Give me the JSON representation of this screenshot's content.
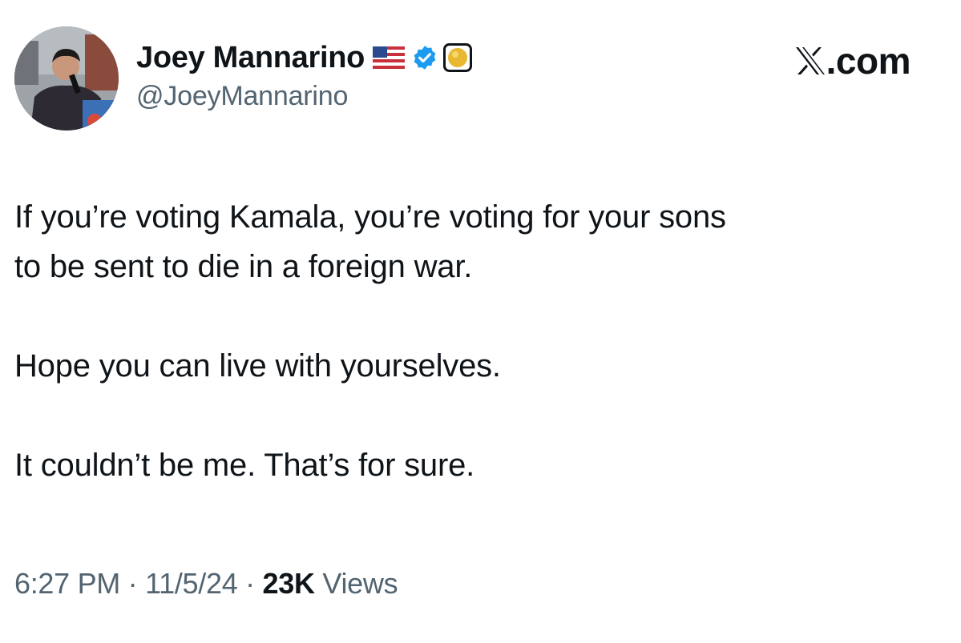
{
  "author": {
    "display_name": "Joey Mannarino",
    "handle": "@JoeyMannarino",
    "badges": [
      "us-flag-icon",
      "verified-icon",
      "affiliate-icon"
    ],
    "avatar": "avatar"
  },
  "brand": {
    "text": ".com"
  },
  "tweet": {
    "line1": "If you’re voting Kamala, you’re voting for your sons",
    "line2": "to be sent to die in a foreign war.",
    "paragraph2": "Hope you can live with yourselves.",
    "paragraph3": "It couldn’t be me. That’s for sure."
  },
  "meta": {
    "time": "6:27 PM",
    "sep1": "·",
    "date": "11/5/24",
    "sep2": "·",
    "views_count": "23K",
    "views_label": "Views"
  },
  "colors": {
    "text": "#0f1419",
    "secondary": "#536471",
    "verified_blue": "#1d9bf0"
  }
}
